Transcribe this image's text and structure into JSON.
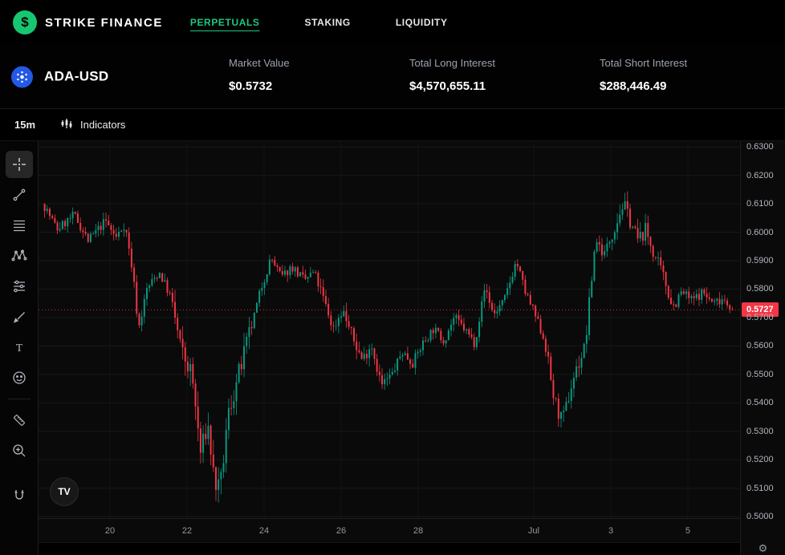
{
  "header": {
    "brand": "STRIKE FINANCE",
    "logo_glyph": "$",
    "accent_color": "#1ec780",
    "nav": [
      {
        "label": "PERPETUALS",
        "active": true
      },
      {
        "label": "STAKING",
        "active": false
      },
      {
        "label": "LIQUIDITY",
        "active": false
      }
    ]
  },
  "stats": {
    "symbol": "ADA-USD",
    "symbol_icon": "cardano-icon",
    "items": [
      {
        "label": "Market Value",
        "value": "$0.5732"
      },
      {
        "label": "Total Long Interest",
        "value": "$4,570,655.11"
      },
      {
        "label": "Total Short Interest",
        "value": "$288,446.49"
      }
    ]
  },
  "chart_toolbar": {
    "timeframe": "15m",
    "indicators_label": "Indicators"
  },
  "drawing_tools": [
    "crosshair",
    "trend-line",
    "fib-retracement",
    "xabcd-pattern",
    "forecast",
    "brush",
    "text",
    "emoji",
    "ruler",
    "zoom-in",
    "magnet"
  ],
  "tv_logo": "TV",
  "axis_settings_glyph": "⚙",
  "chart_data": {
    "type": "candlestick",
    "symbol": "ADA-USD",
    "interval": "15m",
    "up_color": "#089981",
    "down_color": "#f23645",
    "grid_color": "#181818",
    "vgrid_color": "#141414",
    "current_price": "0.5727",
    "current_price_value": 0.5727,
    "y_range": [
      0.4995,
      0.632
    ],
    "y_axis_labels": [
      "0.6300",
      "0.6200",
      "0.6100",
      "0.6000",
      "0.5900",
      "0.5800",
      "0.5700",
      "0.5600",
      "0.5500",
      "0.5400",
      "0.5300",
      "0.5200",
      "0.5100",
      "0.5000"
    ],
    "x_axis_labels": [
      {
        "label": "20",
        "t": 0.1018
      },
      {
        "label": "22",
        "t": 0.2117
      },
      {
        "label": "24",
        "t": 0.3215
      },
      {
        "label": "26",
        "t": 0.4313
      },
      {
        "label": "28",
        "t": 0.5412
      },
      {
        "label": "Jul",
        "t": 0.7059
      },
      {
        "label": "3",
        "t": 0.8158
      },
      {
        "label": "5",
        "t": 0.9256
      }
    ],
    "num_candles": 270,
    "base_volatility": 0.0035,
    "vol_zones": [
      {
        "from": 0.19,
        "to": 0.3,
        "mult": 2.2
      },
      {
        "from": 0.4,
        "to": 0.5,
        "mult": 1.3
      },
      {
        "from": 0.73,
        "to": 0.8,
        "mult": 1.6
      },
      {
        "from": 0.82,
        "to": 0.92,
        "mult": 1.5
      }
    ],
    "price_path": [
      [
        0.0,
        0.61
      ],
      [
        0.02,
        0.601
      ],
      [
        0.045,
        0.606
      ],
      [
        0.065,
        0.597
      ],
      [
        0.09,
        0.604
      ],
      [
        0.105,
        0.598
      ],
      [
        0.118,
        0.603
      ],
      [
        0.13,
        0.585
      ],
      [
        0.138,
        0.566
      ],
      [
        0.15,
        0.58
      ],
      [
        0.168,
        0.586
      ],
      [
        0.185,
        0.577
      ],
      [
        0.2,
        0.558
      ],
      [
        0.215,
        0.55
      ],
      [
        0.228,
        0.522
      ],
      [
        0.238,
        0.533
      ],
      [
        0.248,
        0.512
      ],
      [
        0.256,
        0.509
      ],
      [
        0.268,
        0.536
      ],
      [
        0.282,
        0.549
      ],
      [
        0.3,
        0.565
      ],
      [
        0.315,
        0.58
      ],
      [
        0.33,
        0.591
      ],
      [
        0.345,
        0.584
      ],
      [
        0.36,
        0.588
      ],
      [
        0.378,
        0.583
      ],
      [
        0.392,
        0.586
      ],
      [
        0.405,
        0.577
      ],
      [
        0.42,
        0.566
      ],
      [
        0.433,
        0.573
      ],
      [
        0.448,
        0.563
      ],
      [
        0.462,
        0.555
      ],
      [
        0.475,
        0.561
      ],
      [
        0.49,
        0.546
      ],
      [
        0.505,
        0.55
      ],
      [
        0.52,
        0.558
      ],
      [
        0.535,
        0.554
      ],
      [
        0.55,
        0.561
      ],
      [
        0.565,
        0.566
      ],
      [
        0.58,
        0.562
      ],
      [
        0.595,
        0.57
      ],
      [
        0.61,
        0.566
      ],
      [
        0.625,
        0.561
      ],
      [
        0.64,
        0.581
      ],
      [
        0.652,
        0.571
      ],
      [
        0.668,
        0.576
      ],
      [
        0.685,
        0.59
      ],
      [
        0.698,
        0.579
      ],
      [
        0.712,
        0.571
      ],
      [
        0.726,
        0.562
      ],
      [
        0.74,
        0.541
      ],
      [
        0.752,
        0.533
      ],
      [
        0.768,
        0.549
      ],
      [
        0.785,
        0.56
      ],
      [
        0.8,
        0.598
      ],
      [
        0.812,
        0.592
      ],
      [
        0.826,
        0.601
      ],
      [
        0.84,
        0.61
      ],
      [
        0.852,
        0.603
      ],
      [
        0.862,
        0.597
      ],
      [
        0.872,
        0.601
      ],
      [
        0.885,
        0.592
      ],
      [
        0.9,
        0.583
      ],
      [
        0.912,
        0.574
      ],
      [
        0.925,
        0.579
      ],
      [
        0.94,
        0.576
      ],
      [
        0.955,
        0.579
      ],
      [
        0.97,
        0.575
      ],
      [
        0.985,
        0.577
      ],
      [
        1.0,
        0.5727
      ]
    ]
  }
}
